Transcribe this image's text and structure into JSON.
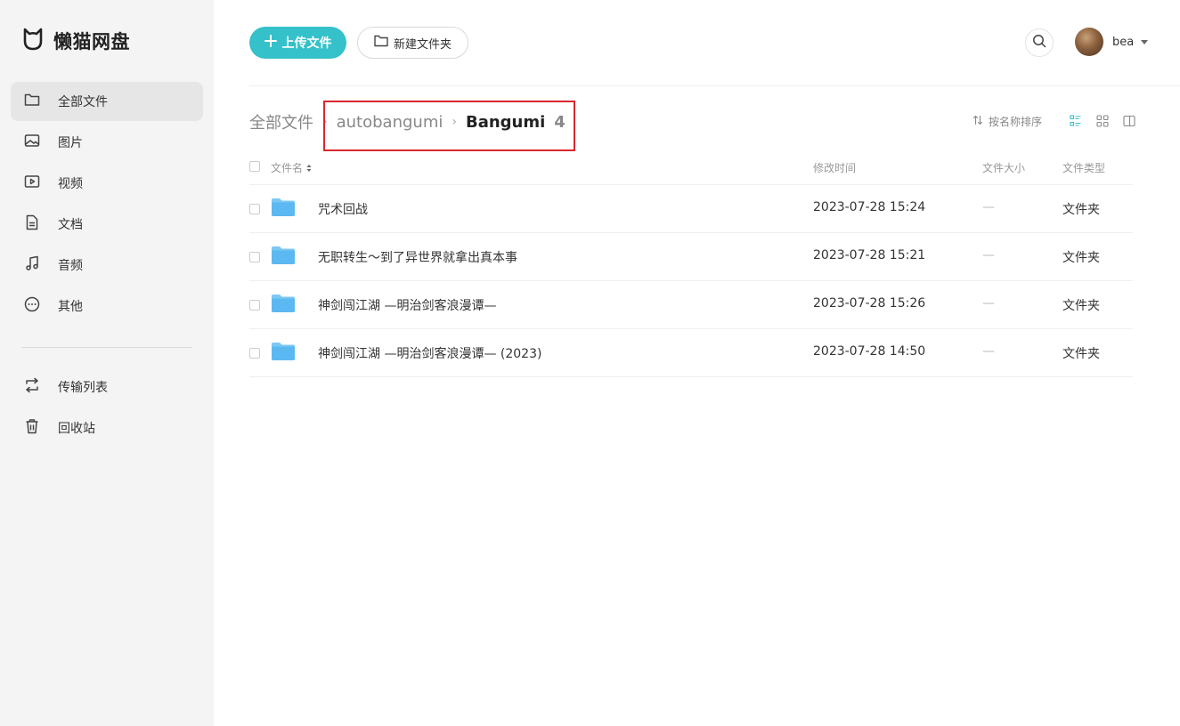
{
  "app": {
    "name": "懒猫网盘"
  },
  "sidebar": {
    "items": [
      {
        "label": "全部文件",
        "icon": "folder-icon",
        "active": true
      },
      {
        "label": "图片",
        "icon": "image-icon"
      },
      {
        "label": "视频",
        "icon": "video-icon"
      },
      {
        "label": "文档",
        "icon": "document-icon"
      },
      {
        "label": "音频",
        "icon": "music-icon"
      },
      {
        "label": "其他",
        "icon": "more-icon"
      }
    ],
    "bottom_items": [
      {
        "label": "传输列表",
        "icon": "transfer-icon"
      },
      {
        "label": "回收站",
        "icon": "trash-icon"
      }
    ]
  },
  "toolbar": {
    "upload_label": "上传文件",
    "new_folder_label": "新建文件夹"
  },
  "user": {
    "name": "bea"
  },
  "breadcrumb": {
    "root": "全部文件",
    "parent": "autobangumi",
    "current": "Bangumi",
    "count": "4"
  },
  "sort": {
    "label": "按名称排序"
  },
  "table": {
    "headers": {
      "name": "文件名",
      "modified": "修改时间",
      "size": "文件大小",
      "type": "文件类型"
    },
    "rows": [
      {
        "name": "咒术回战",
        "modified": "2023-07-28 15:24",
        "size": "—",
        "type": "文件夹"
      },
      {
        "name": "无职转生～到了异世界就拿出真本事",
        "modified": "2023-07-28 15:21",
        "size": "—",
        "type": "文件夹"
      },
      {
        "name": "神剑闯江湖 —明治剑客浪漫谭—",
        "modified": "2023-07-28 15:26",
        "size": "—",
        "type": "文件夹"
      },
      {
        "name": "神剑闯江湖 —明治剑客浪漫谭— (2023)",
        "modified": "2023-07-28 14:50",
        "size": "—",
        "type": "文件夹"
      }
    ]
  },
  "colors": {
    "accent": "#35c1c9",
    "highlight": "#d9262f",
    "folder": "#5cb8f0"
  }
}
